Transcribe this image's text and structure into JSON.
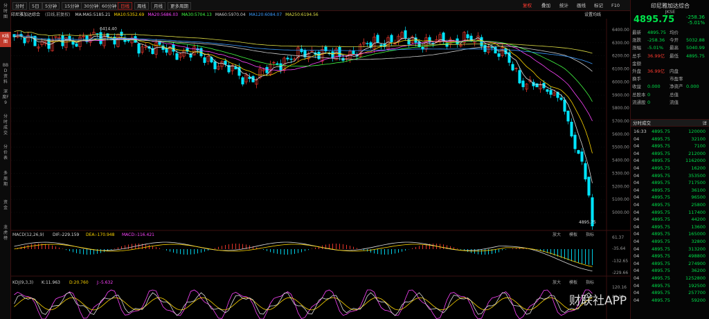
{
  "sidebar": [
    "分时图",
    "K线图",
    "BBD资料",
    "深度F9",
    "分时成交",
    "分价表",
    "多周期",
    "资金",
    "龙虎榜"
  ],
  "toolbar": {
    "left": [
      "分时",
      "5日",
      "5分钟",
      "15分钟",
      "30分钟",
      "60分钟",
      "日线",
      "周线",
      "月线",
      "更多周期"
    ],
    "active": "日线",
    "right": [
      "复权",
      "叠加",
      "统计",
      "画线",
      "标记",
      "F10"
    ]
  },
  "chart_title": "印尼雅加达综合",
  "chart_sub": "(日线,前复权)",
  "ma_labels": [
    {
      "text": "MA:MA5:5185.21",
      "color": "#dddddd"
    },
    {
      "text": "MA10:5352.69",
      "color": "#ffd700"
    },
    {
      "text": "MA20:5686.03",
      "color": "#ff44ff"
    },
    {
      "text": "MA30:5704.13",
      "color": "#44ff44"
    },
    {
      "text": "MA60:5970.04",
      "color": "#cccccc"
    },
    {
      "text": "MA120:6084.07",
      "color": "#3a9bff"
    },
    {
      "text": "MA250:6194.56",
      "color": "#dddd44"
    }
  ],
  "settings_label": "设置均线",
  "price_axis": [
    "6400.00",
    "6300.00",
    "6200.00",
    "6100.00",
    "6000.00",
    "5900.00",
    "5800.00",
    "5700.00",
    "5600.00",
    "5500.00",
    "5400.00",
    "5300.00",
    "5200.00",
    "5100.00",
    "5000.00"
  ],
  "high_label": "6414.40",
  "last_label": "4895.75",
  "macd": {
    "labels": [
      {
        "text": "MACD(12,26,9)",
        "color": "#cccccc"
      },
      {
        "text": "DIF:-229.159",
        "color": "#dddddd"
      },
      {
        "text": "DEA:-170.948",
        "color": "#ffd700"
      },
      {
        "text": "MACD:-116.421",
        "color": "#ff44ff"
      }
    ],
    "axis": [
      "61.37",
      "-35.64",
      "-132.65",
      "-229.66"
    ],
    "buttons": [
      "放大",
      "模板",
      "指标"
    ]
  },
  "kdj": {
    "labels": [
      {
        "text": "KDJ(9,3,3)",
        "color": "#cccccc"
      },
      {
        "text": "K:11.963",
        "color": "#dddddd"
      },
      {
        "text": "D:20.760",
        "color": "#ffd700"
      },
      {
        "text": "J:-5.632",
        "color": "#ff44ff"
      }
    ],
    "axis": [
      "120.16",
      "83.11"
    ],
    "buttons": [
      "放大",
      "模板",
      "指标"
    ]
  },
  "panel": {
    "title": "印尼雅加达综合",
    "code": "JKSE",
    "price": "4895.75",
    "chg": "-258.36",
    "chg_pct": "-5.01%",
    "rows": [
      [
        "最新",
        "4895.75",
        "均价",
        ""
      ],
      [
        "涨跌",
        "-258.36",
        "今开",
        "5032.88"
      ],
      [
        "涨幅",
        "-5.01%",
        "最高",
        "5040.99"
      ],
      [
        "总手",
        "36.99亿",
        "最低",
        "4895.75"
      ],
      [
        "金额",
        "",
        "",
        ""
      ],
      [
        "外盘",
        "36.99亿",
        "内盘",
        ""
      ],
      [
        "换手",
        "",
        "市盈率",
        ""
      ],
      [
        "收益",
        "0.000",
        "净资产",
        "0.000"
      ],
      [
        "总股本",
        "0",
        "总值",
        ""
      ],
      [
        "流通股",
        "0",
        "流值",
        ""
      ]
    ]
  },
  "trade_header": "分时成交",
  "trade_header_right": "详",
  "trades": [
    [
      "16:33",
      "4895.75",
      "120000"
    ],
    [
      "04",
      "4895.75",
      "32100"
    ],
    [
      "04",
      "4895.75",
      "7100"
    ],
    [
      "04",
      "4895.75",
      "212000"
    ],
    [
      "04",
      "4895.75",
      "1162000"
    ],
    [
      "04",
      "4895.75",
      "16200"
    ],
    [
      "04",
      "4895.75",
      "353500"
    ],
    [
      "04",
      "4895.75",
      "717500"
    ],
    [
      "04",
      "4895.75",
      "36100"
    ],
    [
      "04",
      "4895.75",
      "96500"
    ],
    [
      "04",
      "4895.75",
      "25800"
    ],
    [
      "04",
      "4895.75",
      "117400"
    ],
    [
      "04",
      "4895.75",
      "44200"
    ],
    [
      "04",
      "4895.75",
      "13600"
    ],
    [
      "04",
      "4895.75",
      "165000"
    ],
    [
      "04",
      "4895.75",
      "32800"
    ],
    [
      "04",
      "4895.75",
      "313200"
    ],
    [
      "04",
      "4895.75",
      "498800"
    ],
    [
      "04",
      "4895.75",
      "274900"
    ],
    [
      "04",
      "4895.75",
      "36200"
    ],
    [
      "04",
      "4895.75",
      "1252800"
    ],
    [
      "04",
      "4895.75",
      "192500"
    ],
    [
      "04",
      "4895.75",
      "257700"
    ],
    [
      "04",
      "4895.75",
      "59200"
    ]
  ],
  "watermark": "财联社APP",
  "colors": {
    "up": "#ff3b30",
    "down": "#00e5ff",
    "accent": "#c0392b"
  }
}
